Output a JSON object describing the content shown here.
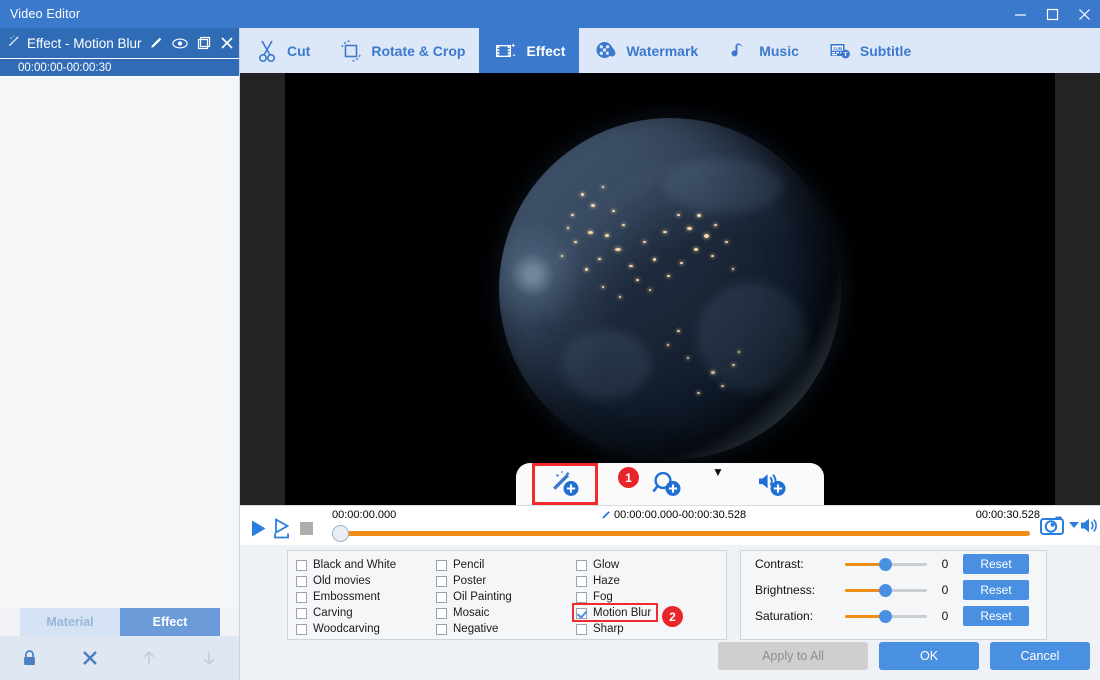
{
  "window": {
    "title": "Video Editor",
    "controls": [
      {
        "name": "minimize-button",
        "label": "—"
      },
      {
        "name": "maximize-button",
        "label": "☐"
      },
      {
        "name": "close-button",
        "label": "✕"
      }
    ]
  },
  "sidebar": {
    "header_title": "Effect - Motion Blur",
    "header_icon": "magic-wand-icon",
    "header_actions": [
      {
        "name": "edit-pencil-icon",
        "label": "Edit"
      },
      {
        "name": "eye-preview-icon",
        "label": "Preview"
      },
      {
        "name": "copy-duplicate-icon",
        "label": "Duplicate"
      },
      {
        "name": "close-icon",
        "label": "Close"
      }
    ],
    "clip_range": "00:00:00-00:00:30",
    "tabs": [
      {
        "name": "material",
        "label": "Material",
        "active": false
      },
      {
        "name": "effect",
        "label": "Effect",
        "active": true
      }
    ],
    "tools": [
      {
        "name": "lock-icon",
        "label": "Lock",
        "enabled": true
      },
      {
        "name": "delete-x-icon",
        "label": "Delete",
        "enabled": true
      },
      {
        "name": "move-up-arrow-icon",
        "label": "Move Up",
        "enabled": false
      },
      {
        "name": "move-down-arrow-icon",
        "label": "Move Down",
        "enabled": false
      }
    ]
  },
  "toolbar": {
    "tabs": [
      {
        "name": "cut",
        "label": "Cut",
        "icon": "scissors-icon",
        "active": false
      },
      {
        "name": "rotate-crop",
        "label": "Rotate & Crop",
        "icon": "rotate-crop-icon",
        "active": false
      },
      {
        "name": "effect",
        "label": "Effect",
        "icon": "film-sparkle-icon",
        "active": true
      },
      {
        "name": "watermark",
        "label": "Watermark",
        "icon": "watermark-droplet-icon",
        "active": false
      },
      {
        "name": "music",
        "label": "Music",
        "icon": "music-note-icon",
        "active": false
      },
      {
        "name": "subtitle",
        "label": "Subtitle",
        "icon": "subtitle-icon",
        "active": false
      }
    ]
  },
  "preview": {
    "content_description": "Earth at night from space",
    "fx_buttons": [
      {
        "name": "add-effect-button",
        "icon": "magic-wand-plus-icon",
        "selected": true,
        "badge": "1"
      },
      {
        "name": "add-zoom-button",
        "icon": "magnifier-plus-icon",
        "selected": false,
        "badge": ""
      },
      {
        "name": "add-audio-button",
        "icon": "speaker-plus-icon",
        "selected": false,
        "badge": ""
      }
    ],
    "collapse_icon": "chevron-down-icon"
  },
  "transport": {
    "play_label": "Play",
    "play_selection_label": "Play Selection",
    "stop_label": "Stop",
    "current_time": "00:00:00.000",
    "selection_range": "00:00:00.000-00:00:30.528",
    "total_time": "00:00:30.528",
    "snapshot_label": "Snapshot",
    "volume_label": "Volume",
    "progress_percent": 0
  },
  "effects": {
    "columns": [
      {
        "items": [
          {
            "label": "Black and White",
            "checked": false
          },
          {
            "label": "Old movies",
            "checked": false
          },
          {
            "label": "Embossment",
            "checked": false
          },
          {
            "label": "Carving",
            "checked": false
          },
          {
            "label": "Woodcarving",
            "checked": false
          }
        ]
      },
      {
        "items": [
          {
            "label": "Pencil",
            "checked": false
          },
          {
            "label": "Poster",
            "checked": false
          },
          {
            "label": "Oil Painting",
            "checked": false
          },
          {
            "label": "Mosaic",
            "checked": false
          },
          {
            "label": "Negative",
            "checked": false
          }
        ]
      },
      {
        "items": [
          {
            "label": "Glow",
            "checked": false
          },
          {
            "label": "Haze",
            "checked": false
          },
          {
            "label": "Fog",
            "checked": false
          },
          {
            "label": "Motion Blur",
            "checked": true
          },
          {
            "label": "Sharp",
            "checked": false
          }
        ]
      }
    ],
    "highlight_badge": "2"
  },
  "adjustments": {
    "rows": [
      {
        "label": "Contrast:",
        "value": "0",
        "reset_label": "Reset"
      },
      {
        "label": "Brightness:",
        "value": "0",
        "reset_label": "Reset"
      },
      {
        "label": "Saturation:",
        "value": "0",
        "reset_label": "Reset"
      }
    ]
  },
  "actions": {
    "apply_to_all": "Apply to All",
    "ok": "OK",
    "cancel": "Cancel"
  },
  "colors": {
    "titlebar": "#3b79cd",
    "accent_blue": "#4a90e2",
    "sidebar_header": "#2f6cb5",
    "slider_orange": "#f08c18",
    "highlight_red": "#ef2b2b",
    "badge_red": "#e8252a"
  }
}
